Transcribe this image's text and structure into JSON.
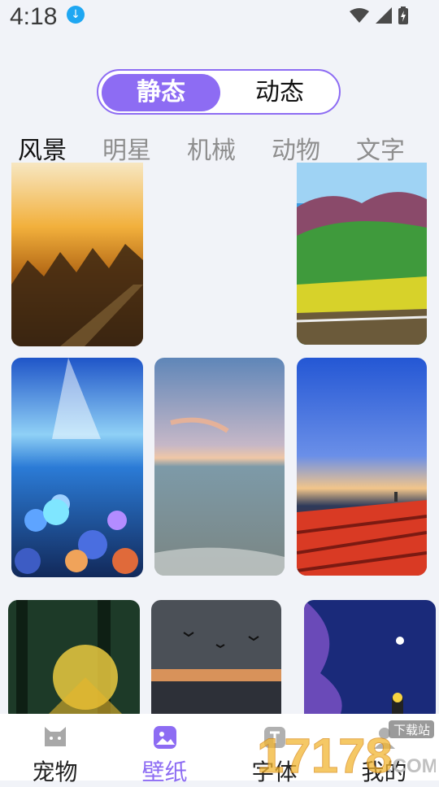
{
  "status_bar": {
    "time": "4:18",
    "download_icon": "download-icon",
    "icons": [
      "wifi-icon",
      "signal-icon",
      "battery-icon"
    ]
  },
  "segment": {
    "static": "静态",
    "dynamic": "动态",
    "selected": "静态"
  },
  "categories": [
    "风景",
    "明星",
    "机械",
    "动物",
    "文字"
  ],
  "active_category": "风景",
  "nav": [
    {
      "label": "宠物",
      "icon": "pet-icon"
    },
    {
      "label": "壁纸",
      "icon": "wallpaper-icon"
    },
    {
      "label": "字体",
      "icon": "font-icon"
    },
    {
      "label": "我的",
      "icon": "profile-icon"
    }
  ],
  "active_nav": "壁纸",
  "watermark": {
    "text": "下载站",
    "brand": "17178",
    "suffix": ".COM"
  },
  "accent": "#8d6cf3"
}
